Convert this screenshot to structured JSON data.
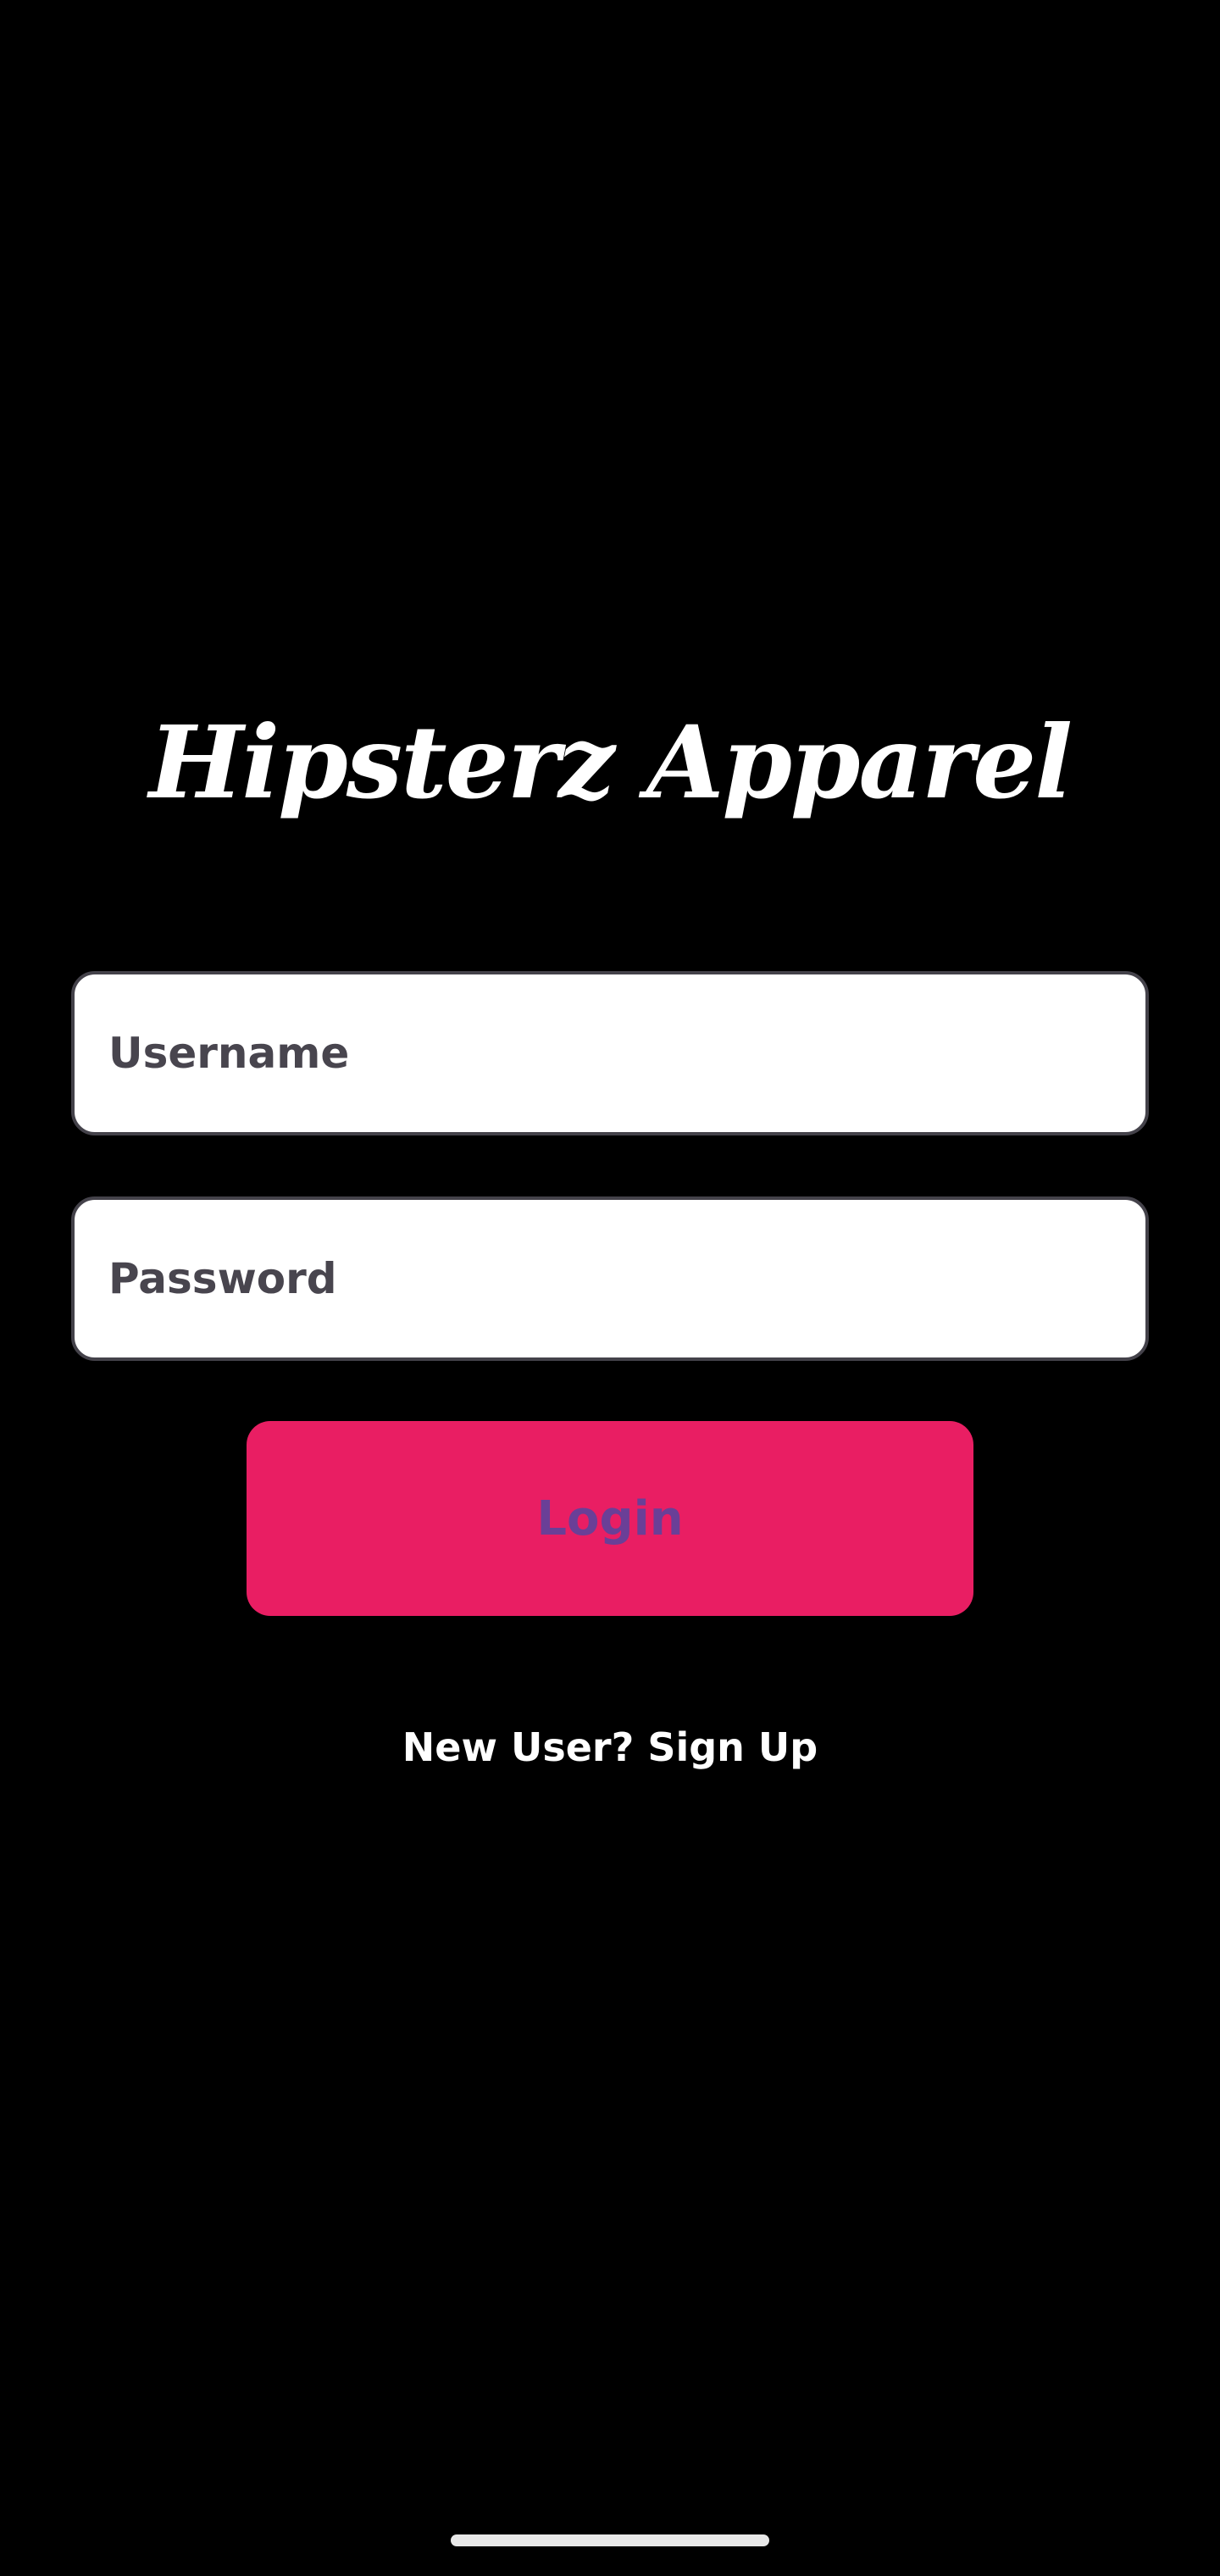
{
  "app": {
    "title": "Hipsterz Apparel"
  },
  "form": {
    "username_placeholder": "Username",
    "password_placeholder": "Password",
    "login_label": "Login",
    "signup_label": "New User? Sign Up"
  },
  "colors": {
    "background": "#000000",
    "button": "#e91e63",
    "button_text": "#6a3f97",
    "field_border": "#44424a"
  }
}
